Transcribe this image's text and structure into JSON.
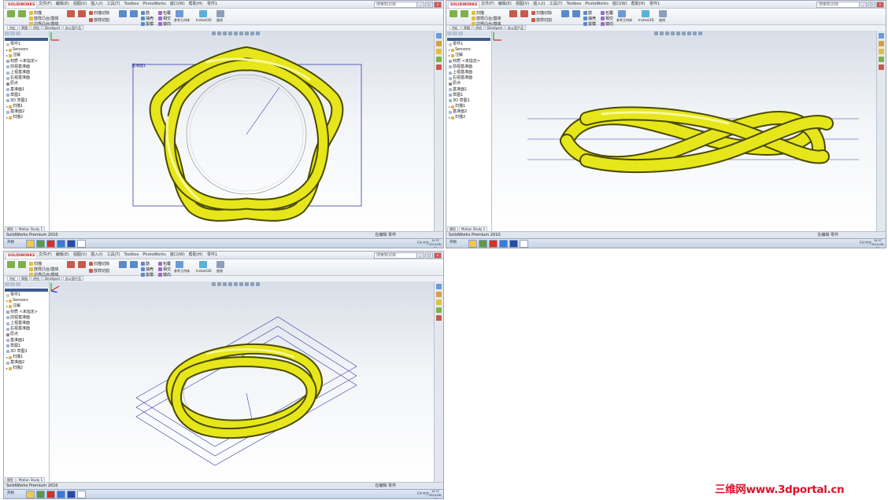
{
  "app": {
    "logo": "SOLIDWORKS",
    "menus": [
      "文件(F)",
      "编辑(E)",
      "视图(V)",
      "插入(I)",
      "工具(T)",
      "Toolbox",
      "PhotoWorks",
      "窗口(W)",
      "帮助(H)"
    ],
    "doc_title": "零件1",
    "search_placeholder": "搜索知识库"
  },
  "ribbon": {
    "items": [
      {
        "label": "扫描"
      },
      {
        "label": "放样凸台/基体"
      },
      {
        "label": "边界凸台/基体"
      },
      {
        "label": "拉伸切除"
      },
      {
        "label": "旋转切除"
      },
      {
        "label": "扫描切除"
      },
      {
        "label": "放样切割"
      },
      {
        "label": "圆角"
      },
      {
        "label": "线性阵列"
      },
      {
        "label": "筋"
      },
      {
        "label": "抽壳"
      },
      {
        "label": "拔模"
      },
      {
        "label": "包覆"
      },
      {
        "label": "相交"
      },
      {
        "label": "镜向"
      },
      {
        "label": "参考几何体"
      },
      {
        "label": "曲线"
      },
      {
        "label": "Instant3D"
      }
    ]
  },
  "cmd_tabs": [
    "特征",
    "草图",
    "评估",
    "DimXpert",
    "办公室产品"
  ],
  "feature_tree": {
    "items": [
      "零件1",
      "Sensors",
      "注解",
      "材质 <未指定>",
      "前视基准面",
      "上视基准面",
      "右视基准面",
      "原点",
      "基准面1",
      "草图1",
      "3D 草图1",
      "扫描1",
      "基准面2",
      "扫描2"
    ]
  },
  "viewports": [
    {
      "view": "top",
      "plane_label": "基准面1"
    },
    {
      "view": "front",
      "plane_label": ""
    },
    {
      "view": "iso",
      "plane_label": ""
    }
  ],
  "status": {
    "left": "SolidWorks Premium 2010",
    "right": "在编辑 零件",
    "tabs": [
      "模型",
      "Motion Study 1"
    ]
  },
  "taskbar": {
    "start": "开始",
    "tray": "CH 中文",
    "time": "10:37",
    "date": "2014-08-26"
  },
  "watermark": "三维网www.3dportal.cn",
  "colors": {
    "tube": "#e6e61a",
    "tube_edge": "#4a4a00",
    "plane": "#3a3aa8",
    "watermark": "#e0102a"
  }
}
